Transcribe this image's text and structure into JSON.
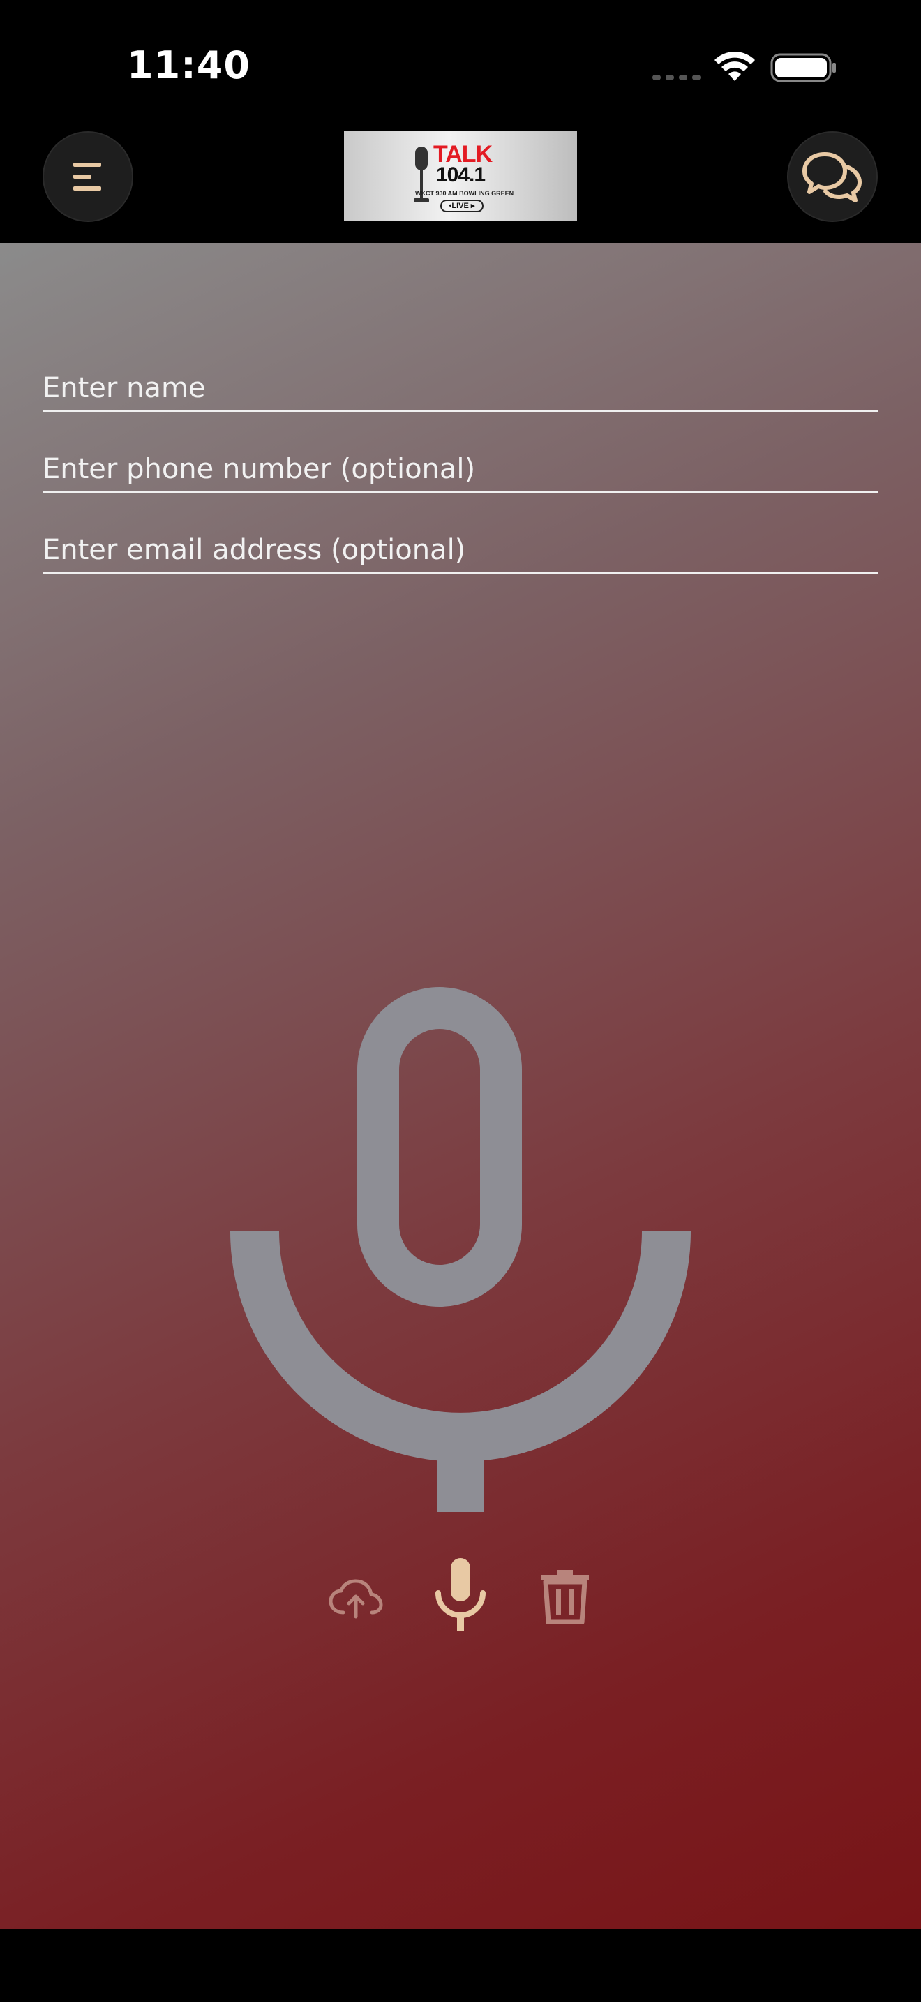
{
  "status_bar": {
    "time": "11:40"
  },
  "header": {
    "menu_icon": "menu-icon",
    "chat_icon": "chat-bubbles-icon",
    "logo": {
      "title": "TALK",
      "frequency": "104.1",
      "subtitle": "WKCT 930 AM BOWLING GREEN",
      "live_badge": "•LIVE ▸"
    }
  },
  "form": {
    "name_placeholder": "Enter name",
    "phone_placeholder": "Enter phone number (optional)",
    "email_placeholder": "Enter email address (optional)",
    "name_value": "",
    "phone_value": "",
    "email_value": ""
  },
  "controls": {
    "upload_icon": "cloud-upload-icon",
    "record_icon": "microphone-icon",
    "delete_icon": "trash-icon"
  },
  "colors": {
    "accent": "#e8c9a4",
    "upload_tint": "#b8847c",
    "delete_tint": "#b8847c",
    "big_mic": "#8e8e95",
    "gradient_start": "#8b8b8b",
    "gradient_end": "#781417"
  }
}
